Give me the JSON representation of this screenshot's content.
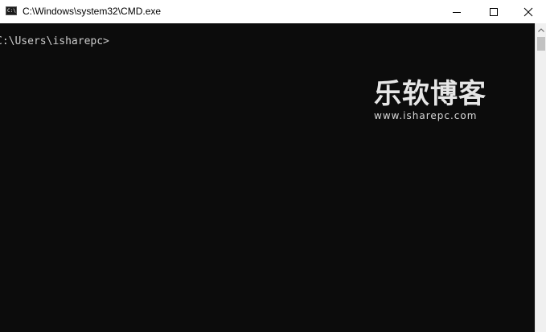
{
  "window": {
    "title": "C:\\Windows\\system32\\CMD.exe",
    "icon": "cmd-icon",
    "icon_glyph": "C:\\"
  },
  "controls": {
    "minimize": "minimize-icon",
    "maximize": "maximize-icon",
    "close": "close-icon"
  },
  "console": {
    "prompt": "C:\\Users\\isharepc>",
    "background": "#0c0c0c",
    "foreground": "#cccccc"
  },
  "watermark": {
    "title": "乐软博客",
    "url": "www.isharepc.com"
  }
}
